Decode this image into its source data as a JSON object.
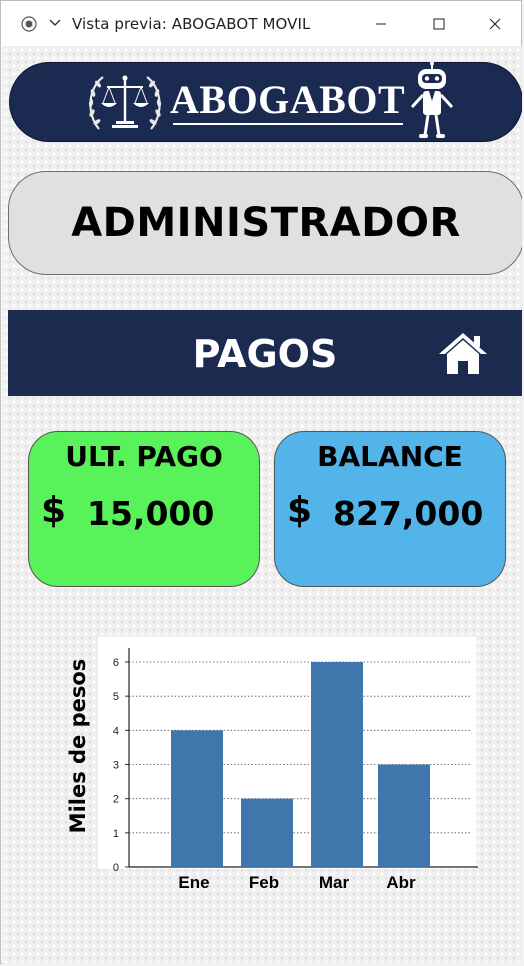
{
  "window": {
    "title": "Vista previa: ABOGABOT MOVIL",
    "app_icon": "record-icon",
    "menu_icon": "chevron-down-icon",
    "controls": [
      "minimize-icon",
      "maximize-icon",
      "close-icon"
    ]
  },
  "header": {
    "logo_text": "ABOGABOT",
    "emblem_icon": "scales-of-justice-icon",
    "mascot_icon": "robot-icon",
    "banner_color": "#1a2a50"
  },
  "role": {
    "label": "ADMINISTRADOR"
  },
  "section": {
    "title": "PAGOS",
    "home_icon": "home-icon",
    "bar_color": "#1c2a4f"
  },
  "cards": {
    "last_payment": {
      "title": "ULT. PAGO",
      "currency": "$",
      "value": "15,000",
      "color": "#59f25a"
    },
    "balance": {
      "title": "BALANCE",
      "currency": "$",
      "value": "827,000",
      "color": "#52b4e8"
    }
  },
  "chart_data": {
    "type": "bar",
    "categories": [
      "Ene",
      "Feb",
      "Mar",
      "Abr"
    ],
    "values": [
      4,
      2,
      6,
      3
    ],
    "title": "",
    "xlabel": "",
    "ylabel": "Miles de pesos",
    "ylim": [
      0,
      6
    ],
    "yticks": [
      "0",
      "1",
      "2",
      "3",
      "4",
      "5",
      "6"
    ],
    "grid": "dotted horizontal",
    "bar_color": "#3f77ac"
  }
}
